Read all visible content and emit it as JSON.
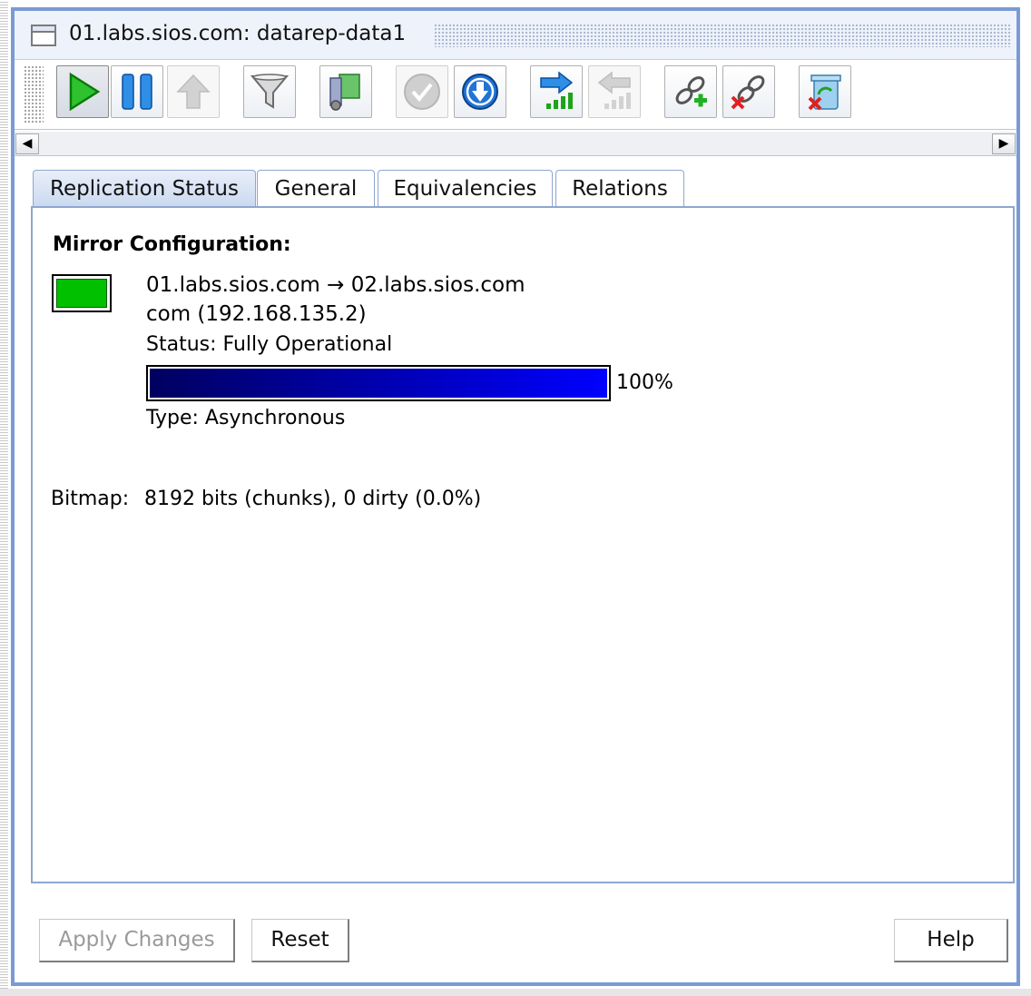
{
  "window": {
    "title": "01.labs.sios.com: datarep-data1"
  },
  "toolbar": {
    "buttons": [
      {
        "name": "play-resume-icon",
        "state": "pressed"
      },
      {
        "name": "pause-icon",
        "state": "normal"
      },
      {
        "name": "up-arrow-icon",
        "state": "disabled"
      },
      {
        "name": "filter-funnel-icon",
        "state": "normal"
      },
      {
        "name": "resource-tree-icon",
        "state": "normal"
      },
      {
        "name": "checkmark-icon",
        "state": "disabled"
      },
      {
        "name": "down-arrow-circle-icon",
        "state": "normal"
      },
      {
        "name": "switchover-right-icon",
        "state": "normal"
      },
      {
        "name": "switchover-left-icon",
        "state": "disabled"
      },
      {
        "name": "add-link-icon",
        "state": "normal"
      },
      {
        "name": "remove-link-icon",
        "state": "normal"
      },
      {
        "name": "delete-trash-icon",
        "state": "normal"
      }
    ]
  },
  "scroll": {
    "left_arrow": "◀",
    "right_arrow": "▶"
  },
  "tabs": [
    {
      "label": "Replication Status",
      "active": true
    },
    {
      "label": "General",
      "active": false
    },
    {
      "label": "Equivalencies",
      "active": false
    },
    {
      "label": "Relations",
      "active": false
    }
  ],
  "replication": {
    "section_title": "Mirror Configuration:",
    "state_color": "#00c000",
    "mirror_path": "01.labs.sios.com → 02.labs.sios.com",
    "target_address": "com (192.168.135.2)",
    "status": "Status: Fully Operational",
    "progress_value": 100,
    "progress_text": "100%",
    "type": "Type: Asynchronous",
    "bitmap_label": "Bitmap:",
    "bitmap_value": "8192 bits (chunks), 0 dirty (0.0%)"
  },
  "footer": {
    "apply_label": "Apply Changes",
    "reset_label": "Reset",
    "help_label": "Help"
  },
  "colors": {
    "frame_border": "#7a9ad6",
    "progress_start": "#000060",
    "progress_end": "#0000ff",
    "status_ok": "#00c000"
  }
}
